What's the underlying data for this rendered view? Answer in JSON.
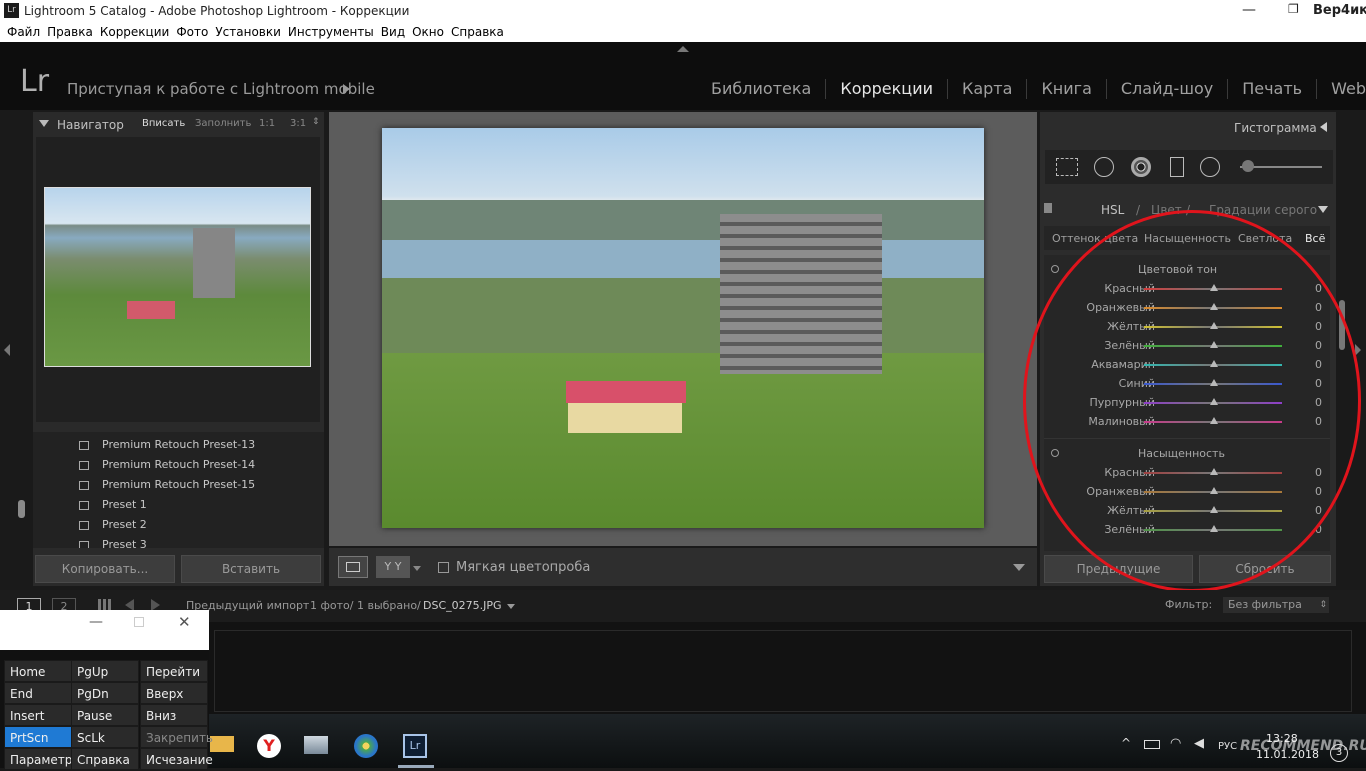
{
  "window": {
    "title": "Lightroom 5 Catalog - Adobe Photoshop Lightroom - Коррекции",
    "user": "Вер4ик"
  },
  "menu": [
    "Файл",
    "Правка",
    "Коррекции",
    "Фото",
    "Установки",
    "Инструменты",
    "Вид",
    "Окно",
    "Справка"
  ],
  "header": {
    "logo": "Lr",
    "identity": "Приступая к работе с Lightroom mobile",
    "modules": [
      "Библиотека",
      "Коррекции",
      "Карта",
      "Книга",
      "Слайд-шоу",
      "Печать",
      "Web"
    ],
    "active_module": "Коррекции"
  },
  "navigator": {
    "title": "Навигатор",
    "fit": "Вписать",
    "fill": "Заполнить",
    "ratio1": "1:1",
    "ratio3": "3:1"
  },
  "presets": [
    "Premium Retouch Preset-13",
    "Premium Retouch Preset-14",
    "Premium Retouch Preset-15",
    "Preset 1",
    "Preset 2",
    "Preset 3"
  ],
  "left_buttons": {
    "copy": "Копировать...",
    "paste": "Вставить"
  },
  "toolbar": {
    "soft_proof": "Мягкая цветопроба",
    "yy": "Y Y"
  },
  "right": {
    "histogram": "Гистограмма",
    "hsl_tabs": {
      "hsl": "HSL",
      "sep1": "/",
      "color": "Цвет",
      "sep2": "/",
      "gray": "Градации серого"
    },
    "sub_tabs": [
      "Оттенок цвета",
      "Насыщенность",
      "Светлота",
      "Всё"
    ],
    "hue_title": "Цветовой тон",
    "sat_title": "Насыщенность",
    "hue": [
      {
        "label": "Красный",
        "value": "0",
        "color": "#d23c3c"
      },
      {
        "label": "Оранжевый",
        "value": "0",
        "color": "#d98a2c"
      },
      {
        "label": "Жёлтый",
        "value": "0",
        "color": "#cfc032"
      },
      {
        "label": "Зелёный",
        "value": "0",
        "color": "#3fae3a"
      },
      {
        "label": "Аквамарин",
        "value": "0",
        "color": "#33b7b0"
      },
      {
        "label": "Синий",
        "value": "0",
        "color": "#3a58cf"
      },
      {
        "label": "Пурпурный",
        "value": "0",
        "color": "#8e3ec9"
      },
      {
        "label": "Малиновый",
        "value": "0",
        "color": "#c93a8a"
      }
    ],
    "sat": [
      {
        "label": "Красный",
        "value": "0",
        "color": "#a04040"
      },
      {
        "label": "Оранжевый",
        "value": "0",
        "color": "#a8783a"
      },
      {
        "label": "Жёлтый",
        "value": "0",
        "color": "#a7a042"
      },
      {
        "label": "Зелёный",
        "value": "0",
        "color": "#4f9448"
      }
    ],
    "prev_button": "Предыдущие",
    "reset_button": "Сбросить"
  },
  "filmbar": {
    "page1": "1",
    "page2": "2",
    "path": "Предыдущий импорт",
    "count": "1 фото/ 1 выбрано/",
    "file": "DSC_0275.JPG",
    "filter_label": "Фильтр:",
    "filter_value": "Без фильтра"
  },
  "osk": {
    "keys": [
      [
        "Home",
        "PgUp",
        "Перейти"
      ],
      [
        "End",
        "PgDn",
        "Вверх"
      ],
      [
        "Insert",
        "Pause",
        "Вниз"
      ],
      [
        "PrtScn",
        "ScLk",
        "Закрепить"
      ],
      [
        "Параметры",
        "Справка",
        "Исчезание"
      ]
    ]
  },
  "tray": {
    "lang": "РУС",
    "time": "13:28",
    "date": "11.01.2018",
    "notif": "3",
    "watermark": "RECOMMEND.RU"
  }
}
